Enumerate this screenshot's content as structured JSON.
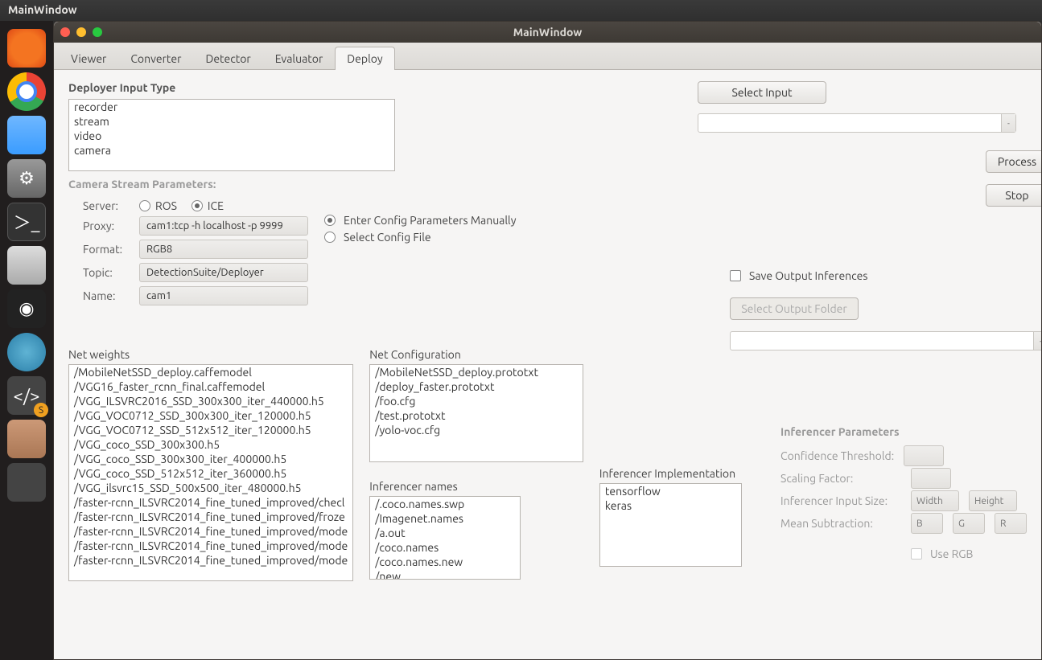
{
  "desktop_title": "MainWindow",
  "window_title": "MainWindow",
  "tabs": [
    "Viewer",
    "Converter",
    "Detector",
    "Evaluator",
    "Deploy"
  ],
  "selected_tab": 4,
  "deployer_input_type_label": "Deployer Input Type",
  "deployer_input_types": [
    "recorder",
    "stream",
    "video",
    "camera"
  ],
  "camera_params_label": "Camera Stream Parameters:",
  "camera": {
    "server_label": "Server:",
    "server_options": [
      "ROS",
      "ICE"
    ],
    "server_selected": 1,
    "proxy_label": "Proxy:",
    "proxy_value": "cam1:tcp -h localhost -p 9999",
    "format_label": "Format:",
    "format_value": "RGB8",
    "topic_label": "Topic:",
    "topic_value": "DetectionSuite/Deployer",
    "name_label": "Name:",
    "name_value": "cam1"
  },
  "config_mode": {
    "manual_label": "Enter Config Parameters Manually",
    "file_label": "Select Config File",
    "selected": 0
  },
  "select_input_label": "Select Input",
  "process_label": "Process",
  "stop_label": "Stop",
  "save_out_label": "Save Output Inferences",
  "select_output_label": "Select Output Folder",
  "net_weights_label": "Net weights",
  "net_weights": [
    "/MobileNetSSD_deploy.caffemodel",
    "/VGG16_faster_rcnn_final.caffemodel",
    "/VGG_ILSVRC2016_SSD_300x300_iter_440000.h5",
    "/VGG_VOC0712_SSD_300x300_iter_120000.h5",
    "/VGG_VOC0712_SSD_512x512_iter_120000.h5",
    "/VGG_coco_SSD_300x300.h5",
    "/VGG_coco_SSD_300x300_iter_400000.h5",
    "/VGG_coco_SSD_512x512_iter_360000.h5",
    "/VGG_ilsvrc15_SSD_500x500_iter_480000.h5",
    "/faster-rcnn_ILSVRC2014_fine_tuned_improved/checl",
    "/faster-rcnn_ILSVRC2014_fine_tuned_improved/froze",
    "/faster-rcnn_ILSVRC2014_fine_tuned_improved/mode",
    "/faster-rcnn_ILSVRC2014_fine_tuned_improved/mode",
    "/faster-rcnn_ILSVRC2014_fine_tuned_improved/mode"
  ],
  "net_config_label": "Net Configuration",
  "net_config": [
    "/MobileNetSSD_deploy.prototxt",
    "/deploy_faster.prototxt",
    "/foo.cfg",
    "/test.prototxt",
    "/yolo-voc.cfg"
  ],
  "inf_names_label": "Inferencer names",
  "inf_names": [
    "/.coco.names.swp",
    "/Imagenet.names",
    "/a.out",
    "/coco.names",
    "/coco.names.new",
    "/new"
  ],
  "inf_impl_label": "Inferencer Implementation",
  "inf_impl": [
    "tensorflow",
    "keras"
  ],
  "inf_params_label": "Inferencer Parameters",
  "inf_params": {
    "conf_label": "Confidence Threshold:",
    "scale_label": "Scaling Factor:",
    "size_label": "Inferencer Input Size:",
    "size_w_ph": "Width",
    "size_h_ph": "Height",
    "mean_label": "Mean Subtraction:",
    "mean_b": "B",
    "mean_g": "G",
    "mean_r": "R",
    "rgb_label": "Use RGB"
  }
}
